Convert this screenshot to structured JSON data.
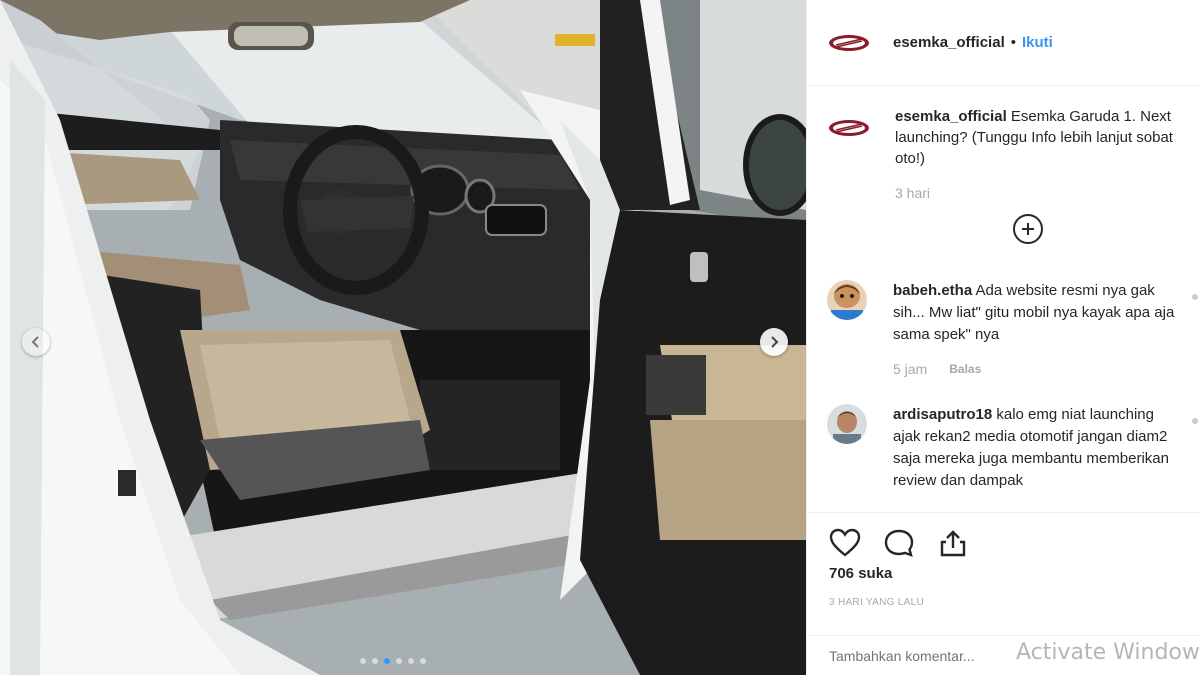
{
  "post": {
    "username": "esemka_official",
    "separator": "•",
    "follow_label": "Ikuti",
    "brand_color": "#8a1c2b",
    "accent_color": "#3897f0"
  },
  "caption": {
    "username": "esemka_official",
    "text": "Esemka Garuda 1. Next launching? (Tunggu Info lebih lanjut sobat oto!)",
    "time": "3 hari"
  },
  "load_more_icon": "plus-circle-icon",
  "comments": [
    {
      "username": "babeh.etha",
      "text": "Ada website resmi nya gak sih... Mw liat\" gitu mobil nya kayak apa aja sama spek\" nya",
      "time": "5 jam",
      "reply_label": "Balas"
    },
    {
      "username": "ardisaputro18",
      "text": "kalo emg niat launching ajak rekan2 media otomotif jangan diam2 saja mereka juga membantu memberikan review dan dampak"
    }
  ],
  "actions": {
    "like_icon": "heart-icon",
    "comment_icon": "comment-bubble-icon",
    "share_icon": "share-icon",
    "likes": "706 suka",
    "posted": "3 HARI YANG LALU"
  },
  "add_comment": {
    "placeholder": "Tambahkan komentar..."
  },
  "os_watermark": "Activate Windows",
  "photo": {
    "description_icon": "car-interior-photo",
    "slide_count": 6,
    "active_slide": 3
  }
}
